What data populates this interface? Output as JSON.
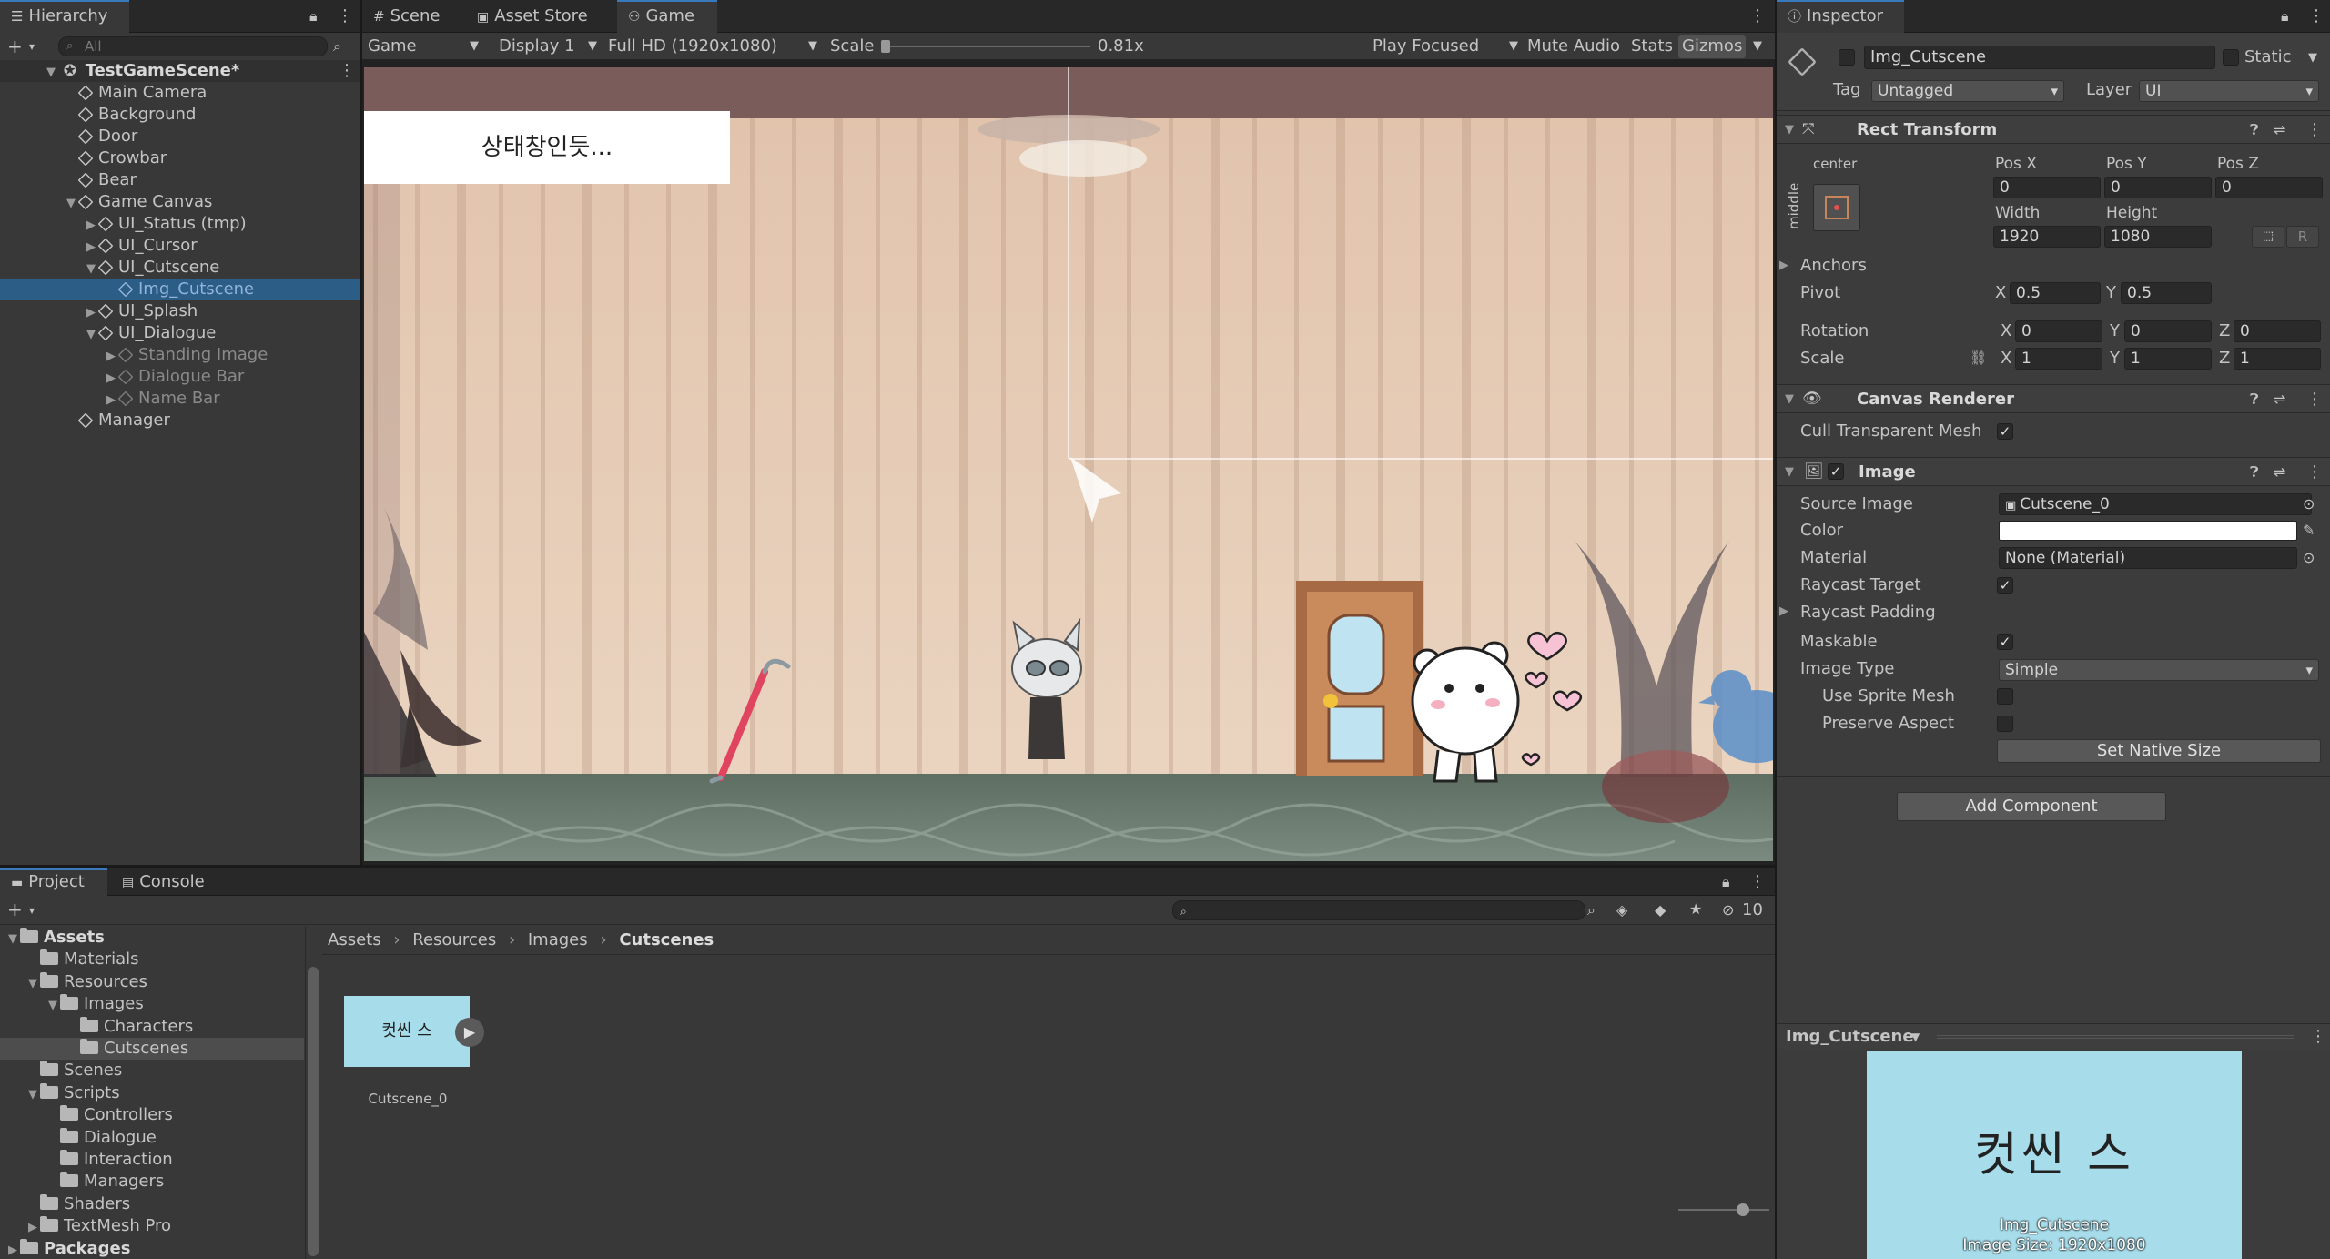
{
  "hierarchy": {
    "tab": "Hierarchy",
    "search_placeholder": "All",
    "scene": "TestGameScene*",
    "items": [
      {
        "label": "Main Camera",
        "depth": 1
      },
      {
        "label": "Background",
        "depth": 1
      },
      {
        "label": "Door",
        "depth": 1
      },
      {
        "label": "Crowbar",
        "depth": 1
      },
      {
        "label": "Bear",
        "depth": 1
      },
      {
        "label": "Game Canvas",
        "depth": 1,
        "expanded": true
      },
      {
        "label": "UI_Status (tmp)",
        "depth": 2,
        "collapsed": true
      },
      {
        "label": "UI_Cursor",
        "depth": 2,
        "collapsed": true
      },
      {
        "label": "UI_Cutscene",
        "depth": 2,
        "expanded": true
      },
      {
        "label": "Img_Cutscene",
        "depth": 3,
        "selected": true,
        "inactive": true
      },
      {
        "label": "UI_Splash",
        "depth": 2,
        "collapsed": true
      },
      {
        "label": "UI_Dialogue",
        "depth": 2,
        "expanded": true
      },
      {
        "label": "Standing Image",
        "depth": 3,
        "collapsed": true,
        "inactive": true
      },
      {
        "label": "Dialogue Bar",
        "depth": 3,
        "collapsed": true,
        "inactive": true
      },
      {
        "label": "Name Bar",
        "depth": 3,
        "collapsed": true,
        "inactive": true
      },
      {
        "label": "Manager",
        "depth": 1
      }
    ]
  },
  "center": {
    "tabs": [
      "Scene",
      "Asset Store",
      "Game"
    ],
    "active_tab": "Game",
    "toolbar": {
      "view_mode": "Game",
      "display": "Display 1",
      "resolution": "Full HD (1920x1080)",
      "scale_label": "Scale",
      "scale_value": "0.81x",
      "play_mode": "Play Focused",
      "mute": "Mute Audio",
      "stats": "Stats",
      "gizmos": "Gizmos"
    },
    "game": {
      "status_text": "상태창인듯..."
    }
  },
  "project": {
    "tabs": [
      "Project",
      "Console"
    ],
    "search_count": "10",
    "tree": [
      {
        "label": "Assets",
        "depth": 0,
        "expanded": true,
        "bold": true
      },
      {
        "label": "Materials",
        "depth": 1
      },
      {
        "label": "Resources",
        "depth": 1,
        "expanded": true
      },
      {
        "label": "Images",
        "depth": 2,
        "expanded": true
      },
      {
        "label": "Characters",
        "depth": 3
      },
      {
        "label": "Cutscenes",
        "depth": 3,
        "selected": true
      },
      {
        "label": "Scenes",
        "depth": 1
      },
      {
        "label": "Scripts",
        "depth": 1,
        "expanded": true
      },
      {
        "label": "Controllers",
        "depth": 2
      },
      {
        "label": "Dialogue",
        "depth": 2
      },
      {
        "label": "Interaction",
        "depth": 2
      },
      {
        "label": "Managers",
        "depth": 2
      },
      {
        "label": "Shaders",
        "depth": 1
      },
      {
        "label": "TextMesh Pro",
        "depth": 1,
        "collapsed": true
      },
      {
        "label": "Packages",
        "depth": 0,
        "collapsed": true,
        "bold": true
      }
    ],
    "breadcrumb": [
      "Assets",
      "Resources",
      "Images",
      "Cutscenes"
    ],
    "asset_name": "Cutscene_0",
    "asset_thumb_text": "컷씬 스"
  },
  "inspector": {
    "tab": "Inspector",
    "object_name": "Img_Cutscene",
    "static_label": "Static",
    "tag_label": "Tag",
    "tag_value": "Untagged",
    "layer_label": "Layer",
    "layer_value": "UI",
    "rect_transform": {
      "title": "Rect Transform",
      "anchor_h": "center",
      "anchor_v": "middle",
      "pos_x_label": "Pos X",
      "pos_x": "0",
      "pos_y_label": "Pos Y",
      "pos_y": "0",
      "pos_z_label": "Pos Z",
      "pos_z": "0",
      "width_label": "Width",
      "width": "1920",
      "height_label": "Height",
      "height": "1080",
      "raw_btn": "R",
      "anchors_label": "Anchors",
      "pivot_label": "Pivot",
      "pivot_x": "0.5",
      "pivot_y": "0.5",
      "rotation_label": "Rotation",
      "rot_x": "0",
      "rot_y": "0",
      "rot_z": "0",
      "scale_label": "Scale",
      "scale_x": "1",
      "scale_y": "1",
      "scale_z": "1",
      "x": "X",
      "y": "Y",
      "z": "Z"
    },
    "canvas_renderer": {
      "title": "Canvas Renderer",
      "cull_label": "Cull Transparent Mesh"
    },
    "image": {
      "title": "Image",
      "source_label": "Source Image",
      "source_value": "Cutscene_0",
      "color_label": "Color",
      "color_value": "#ffffff",
      "material_label": "Material",
      "material_value": "None (Material)",
      "raycast_label": "Raycast Target",
      "padding_label": "Raycast Padding",
      "maskable_label": "Maskable",
      "type_label": "Image Type",
      "type_value": "Simple",
      "sprite_mesh_label": "Use Sprite Mesh",
      "aspect_label": "Preserve Aspect",
      "native_btn": "Set Native Size"
    },
    "add_component": "Add Component",
    "preview": {
      "title": "Img_Cutscene",
      "image_text": "컷씬 스",
      "caption_name": "Img_Cutscene",
      "caption_size": "Image Size: 1920x1080"
    }
  }
}
